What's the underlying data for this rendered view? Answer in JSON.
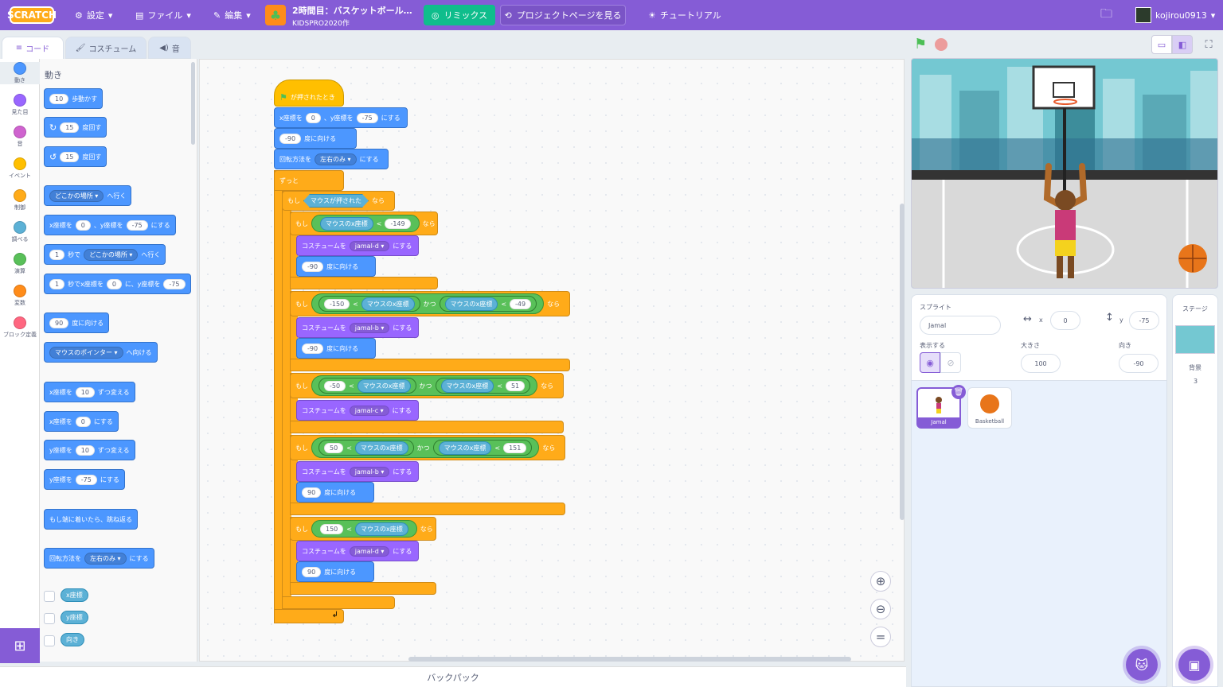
{
  "menubar": {
    "logo": "SCRATCH",
    "settings": "設定",
    "file": "ファイル",
    "edit": "編集",
    "project_title": "2時間目：バスケットボール…",
    "project_author": "KIDSPRO2020作",
    "remix": "リミックス",
    "see_project_page": "プロジェクトページを見る",
    "tutorials": "チュートリアル",
    "username": "kojirou0913",
    "accent_color": "#855cd6"
  },
  "tabs": {
    "code": "コード",
    "costumes": "コスチューム",
    "sounds": "音"
  },
  "categories": [
    {
      "label": "動き",
      "color": "#4c97ff"
    },
    {
      "label": "見た目",
      "color": "#9966ff"
    },
    {
      "label": "音",
      "color": "#cf63cf"
    },
    {
      "label": "イベント",
      "color": "#ffbf00"
    },
    {
      "label": "制御",
      "color": "#ffab19"
    },
    {
      "label": "調べる",
      "color": "#5cb1d6"
    },
    {
      "label": "演算",
      "color": "#59c059"
    },
    {
      "label": "変数",
      "color": "#ff8c1a"
    },
    {
      "label": "ブロック定義",
      "color": "#ff6680"
    }
  ],
  "palette": {
    "heading": "動き",
    "move": {
      "val": "10",
      "text": "歩動かす"
    },
    "turn_right": {
      "val": "15",
      "text": "度回す"
    },
    "turn_left": {
      "val": "15",
      "text": "度回す"
    },
    "goto": {
      "drop": "どこかの場所",
      "text": "へ行く"
    },
    "gotoxy": {
      "t1": "x座標を",
      "x": "0",
      "t2": "、y座標を",
      "y": "-75",
      "t3": "にする"
    },
    "glide": {
      "val": "1",
      "t1": "秒で",
      "drop": "どこかの場所",
      "t2": "へ行く"
    },
    "glidexy": {
      "val": "1",
      "t1": "秒でx座標を",
      "x": "0",
      "t2": "に、y座標を",
      "y": "-75"
    },
    "point": {
      "val": "90",
      "text": "度に向ける"
    },
    "pointtowards": {
      "drop": "マウスのポインター",
      "text": "へ向ける"
    },
    "changex": {
      "t1": "x座標を",
      "val": "10",
      "t2": "ずつ変える"
    },
    "setx": {
      "t1": "x座標を",
      "val": "0",
      "t2": "にする"
    },
    "changey": {
      "t1": "y座標を",
      "val": "10",
      "t2": "ずつ変える"
    },
    "sety": {
      "t1": "y座標を",
      "val": "-75",
      "t2": "にする"
    },
    "bounce": "もし端に着いたら、跳ね返る",
    "rotstyle": {
      "t1": "回転方法を",
      "drop": "左右のみ",
      "t2": "にする"
    },
    "rep_x": "x座標",
    "rep_y": "y座標",
    "rep_dir": "向き"
  },
  "script": {
    "hat": "が押されたとき",
    "gotoxy": {
      "t1": "x座標を",
      "x": "0",
      "t2": "、y座標を",
      "y": "-75",
      "t3": "にする"
    },
    "point": {
      "val": "-90",
      "text": "度に向ける"
    },
    "rotstyle": {
      "t1": "回転方法を",
      "drop": "左右のみ",
      "t2": "にする"
    },
    "forever": "ずっと",
    "if_word": "もし",
    "then_word": "なら",
    "and_word": "かつ",
    "lt": "<",
    "mouse_down": "マウスが押された",
    "mouse_x": "マウスのx座標",
    "costume_set": "コスチュームを",
    "costume_to": "にする",
    "point_text": "度に向ける",
    "if1": {
      "limit": "-149",
      "costume": "jamal-d",
      "dir": "-90"
    },
    "if2": {
      "a": "-150",
      "b": "-49",
      "costume": "jamal-b",
      "dir": "-90"
    },
    "if3": {
      "a": "-50",
      "b": "51",
      "costume": "jamal-c"
    },
    "if4": {
      "a": "50",
      "b": "151",
      "costume": "jamal-b",
      "dir": "90"
    },
    "if5": {
      "a": "150",
      "costume": "jamal-d",
      "dir": "90"
    }
  },
  "backpack": "バックパック",
  "sprite_info": {
    "sprite_label": "スプライト",
    "name": "Jamal",
    "x_label": "x",
    "x": "0",
    "y_label": "y",
    "y": "-75",
    "show_label": "表示する",
    "size_label": "大きさ",
    "size": "100",
    "direction_label": "向き",
    "direction": "-90"
  },
  "sprites": [
    {
      "name": "Jamal",
      "selected": true
    },
    {
      "name": "Basketball",
      "selected": false
    }
  ],
  "stage_pane": {
    "label": "ステージ",
    "backdrops_label": "背景",
    "backdrops_count": "3"
  }
}
